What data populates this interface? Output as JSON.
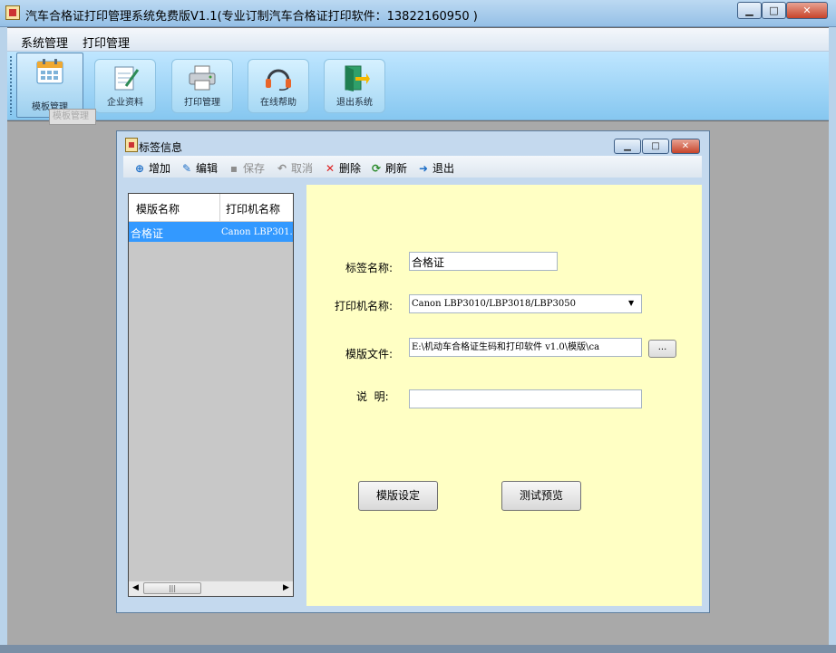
{
  "app": {
    "title": "汽车合格证打印管理系统免费版V1.1(专业订制汽车合格证打印软件：13822160950 )",
    "window_buttons": {
      "minimize": "▁",
      "maximize": "□",
      "close": "✕"
    }
  },
  "menu": {
    "items": [
      {
        "label": "系统管理"
      },
      {
        "label": "打印管理"
      }
    ]
  },
  "toolbar": {
    "buttons": [
      {
        "label": "模板管理",
        "icon": "calendar-icon"
      },
      {
        "label": "企业资料",
        "icon": "notepad-icon"
      },
      {
        "label": "打印管理",
        "icon": "printer-icon"
      },
      {
        "label": "在线帮助",
        "icon": "headset-icon"
      },
      {
        "label": "退出系统",
        "icon": "exit-door-icon"
      }
    ],
    "tooltip": "模板管理"
  },
  "child_window": {
    "title": "标签信息",
    "toolbar": [
      {
        "label": "增加",
        "icon": "add-icon",
        "enabled": true
      },
      {
        "label": "编辑",
        "icon": "edit-icon",
        "enabled": true
      },
      {
        "label": "保存",
        "icon": "save-icon",
        "enabled": false
      },
      {
        "label": "取消",
        "icon": "undo-icon",
        "enabled": false
      },
      {
        "label": "删除",
        "icon": "delete-icon",
        "enabled": true
      },
      {
        "label": "刷新",
        "icon": "refresh-icon",
        "enabled": true
      },
      {
        "label": "退出",
        "icon": "exit-icon",
        "enabled": true
      }
    ],
    "list": {
      "columns": [
        "模版名称",
        "打印机名称"
      ],
      "rows": [
        {
          "template": "合格证",
          "printer": "Canon LBP301..."
        }
      ],
      "scrollbar_thumb": "|||"
    },
    "form": {
      "name_label": "标签名称:",
      "name_value": "合格证",
      "printer_label": "打印机名称:",
      "printer_value": "Canon LBP3010/LBP3018/LBP3050",
      "file_label": "模版文件:",
      "file_value": "E:\\机动车合格证生码和打印软件 v1.0\\模版\\ca",
      "browse_label": "...",
      "desc_label": "说  明:",
      "desc_value": "",
      "template_button": "模版设定",
      "preview_button": "测试预览"
    }
  }
}
